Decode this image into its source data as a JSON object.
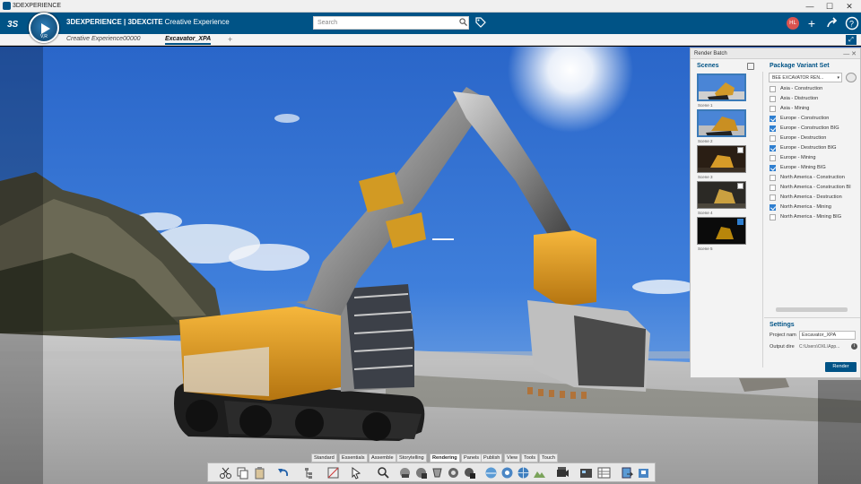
{
  "window": {
    "title": "3DEXPERIENCE",
    "minimize": "—",
    "maximize": "☐",
    "close": "✕"
  },
  "topbar": {
    "brand_bold": "3DEXPERIENCE | 3DEXCITE",
    "brand_sub": "Creative Experience",
    "search_placeholder": "Search",
    "avatar_initials": "HL",
    "compass_label": "V,R"
  },
  "tabs": [
    {
      "label": "Creative Experience00000"
    },
    {
      "label": "Excavator_XPA"
    }
  ],
  "tab_add": "+",
  "panel": {
    "title": "Render Batch",
    "controls": "— ✕",
    "scenes_heading": "Scenes",
    "scenes": [
      {
        "label": "Scene 1",
        "checked": false
      },
      {
        "label": "Scene 2",
        "checked": false
      },
      {
        "label": "Scene 3",
        "checked": false
      },
      {
        "label": "Scene 4",
        "checked": false
      },
      {
        "label": "Scene 5",
        "checked": true
      }
    ],
    "pvs_heading": "Package Variant Set",
    "pvs_selected": "BEE EXCAVATOR REN...",
    "variants": [
      {
        "label": "Asia - Construction",
        "checked": false
      },
      {
        "label": "Asia - Distruction",
        "checked": false
      },
      {
        "label": "Asia - Mining",
        "checked": false
      },
      {
        "label": "Europe - Construction",
        "checked": true
      },
      {
        "label": "Europe - Construction BIG",
        "checked": true
      },
      {
        "label": "Europe - Destruction",
        "checked": false
      },
      {
        "label": "Europe - Destruction BIG",
        "checked": true
      },
      {
        "label": "Europe - Mining",
        "checked": false
      },
      {
        "label": "Europe - Mining BIG",
        "checked": true
      },
      {
        "label": "North America - Construction",
        "checked": false
      },
      {
        "label": "North America - Construction BI",
        "checked": false
      },
      {
        "label": "North America - Destruction",
        "checked": false
      },
      {
        "label": "North America - Mining",
        "checked": true
      },
      {
        "label": "North America - Mining BIG",
        "checked": false
      }
    ],
    "settings_heading": "Settings",
    "project_label": "Project nam",
    "project_value": "Excavator_XPA",
    "output_label": "Output dire",
    "output_value": "C:\\Users\\OXL\\App...",
    "render_button": "Render"
  },
  "action_tabs": [
    "Standard",
    "Essentials",
    "Assemble",
    "Storytelling",
    "Rendering",
    "Panels",
    "Publish",
    "View",
    "Tools",
    "Touch"
  ],
  "active_action_tab": "Rendering",
  "colors": {
    "brand": "#005386",
    "accent": "#2f7fd0"
  }
}
